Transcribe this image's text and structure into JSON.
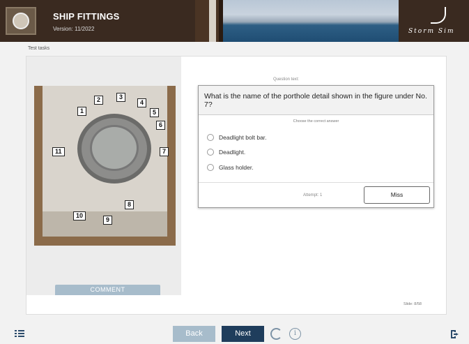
{
  "header": {
    "title": "SHIP FITTINGS",
    "version": "Version: 11/2022",
    "brand": "Storm Sim"
  },
  "breadcrumb": "Test tasks",
  "figure": {
    "labels": [
      "1",
      "2",
      "3",
      "4",
      "5",
      "6",
      "7",
      "8",
      "9",
      "10",
      "11"
    ]
  },
  "comment_label": "COMMENT",
  "question": {
    "caption": "Question text:",
    "text": "What is the name of the porthole detail shown in the figure under No. 7?",
    "choose_prompt": "Choose the correct answer",
    "options": [
      "Deadlight bolt bar.",
      "Deadlight.",
      "Glass holder."
    ],
    "attempt": "Attempt: 1",
    "miss_label": "Miss"
  },
  "slide": "Slide: 8/58",
  "footer": {
    "back_label": "Back",
    "next_label": "Next",
    "info_glyph": "i"
  },
  "colors": {
    "header_bg": "#3a2a20",
    "accent_dark": "#1f3d5c",
    "accent_light": "#a7bccb"
  }
}
